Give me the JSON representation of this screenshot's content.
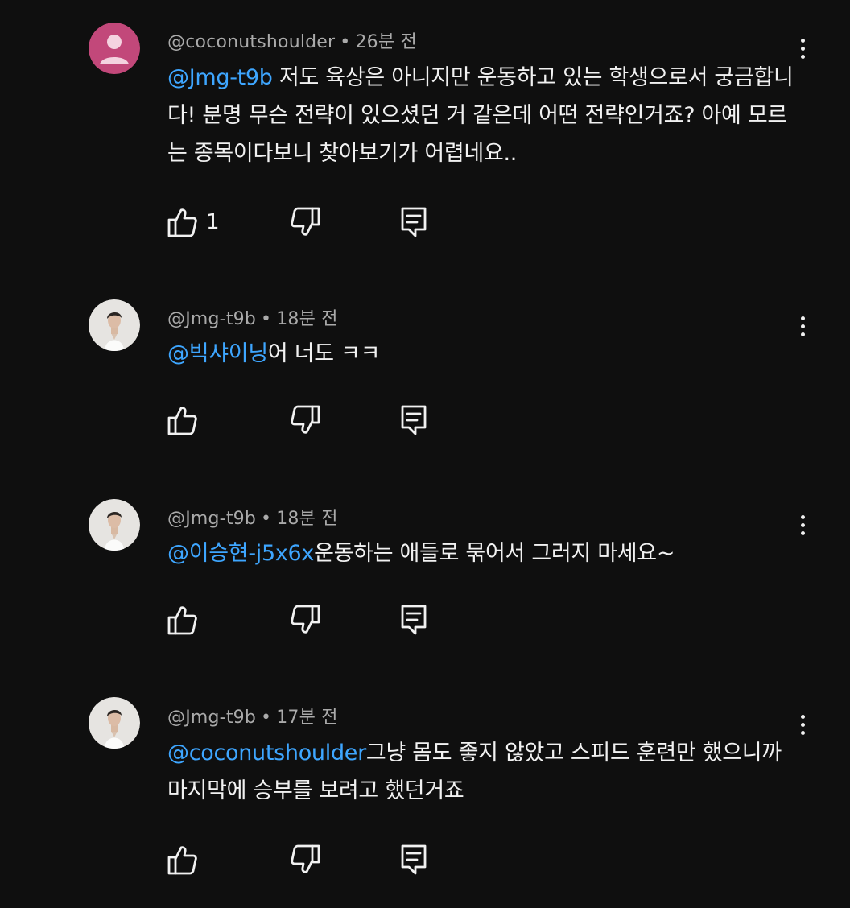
{
  "comments": [
    {
      "author": "@coconutshoulder",
      "dot": "•",
      "time": "26분 전",
      "mention": "@Jmg-t9b",
      "text": " 저도 육상은 아니지만 운동하고 있는 학생으로서 궁금합니다! 분명 무슨 전략이 있으셨던 거 같은데 어떤 전략인거죠? 아예 모르는 종목이다보니 찾아보기가 어렵네요..",
      "likes": "1",
      "avatar": "default-person-avatar-pink"
    },
    {
      "author": "@Jmg-t9b",
      "dot": "•",
      "time": "18분 전",
      "mention": "@빅샤이닝",
      "text": "어 너도 ㅋㅋ",
      "likes": "",
      "avatar": "profile-photo-man-white-shirt"
    },
    {
      "author": "@Jmg-t9b",
      "dot": "•",
      "time": "18분 전",
      "mention": "@이승현-j5x6x",
      "text": "운동하는 애들로 묶어서 그러지 마세요~",
      "likes": "",
      "avatar": "profile-photo-man-white-shirt"
    },
    {
      "author": "@Jmg-t9b",
      "dot": "•",
      "time": "17분 전",
      "mention": "@coconutshoulder",
      "text": "그냥 몸도 좋지 않았고 스피드 훈련만 했으니까 마지막에 승부를 보려고 했던거죠",
      "likes": "",
      "avatar": "profile-photo-man-white-shirt"
    }
  ],
  "icons": {
    "like": "thumbs-up-icon",
    "dislike": "thumbs-down-icon",
    "reply": "reply-comment-icon",
    "more": "more-vert-icon"
  },
  "colors": {
    "background": "#0f0f0f",
    "text": "#f1f1f1",
    "meta": "#aaaaaa",
    "mention": "#3ea6ff",
    "avatar_default": "#c2487a"
  }
}
